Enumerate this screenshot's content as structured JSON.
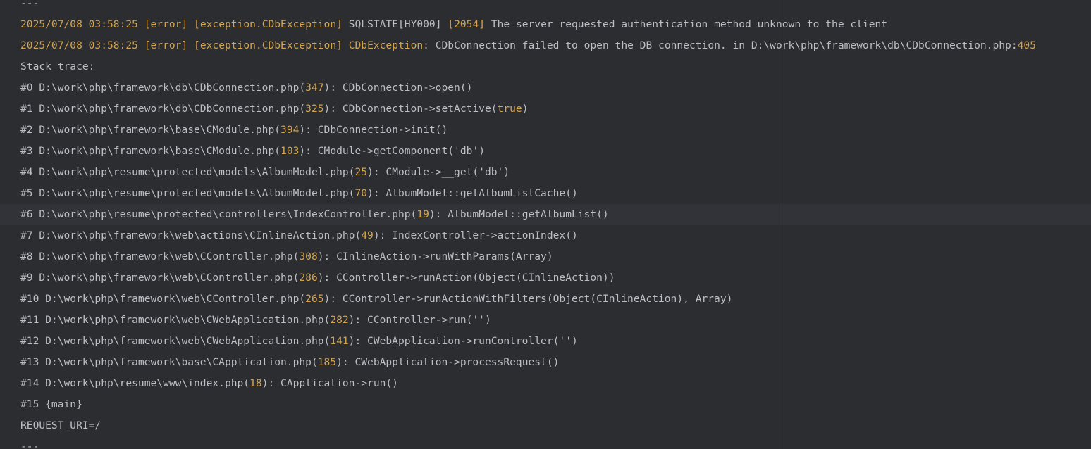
{
  "colors": {
    "background": "#2b2d30",
    "text": "#bcbec4",
    "highlight": "#d5a54e",
    "current_line": "#313339",
    "margin_guide": "#4a4d53"
  },
  "lines": [
    {
      "segs": [
        {
          "t": "---",
          "c": ""
        }
      ]
    },
    {
      "segs": [
        {
          "t": "2025/07/08 03:58:25",
          "c": "date"
        },
        {
          "t": " ",
          "c": ""
        },
        {
          "t": "[error]",
          "c": "kw"
        },
        {
          "t": " ",
          "c": ""
        },
        {
          "t": "[exception.CDbException]",
          "c": "kw"
        },
        {
          "t": " SQLSTATE[HY000] ",
          "c": ""
        },
        {
          "t": "[2054]",
          "c": "kw"
        },
        {
          "t": " The server requested authentication method unknown to the client",
          "c": ""
        }
      ]
    },
    {
      "segs": [
        {
          "t": "2025/07/08 03:58:25",
          "c": "date"
        },
        {
          "t": " ",
          "c": ""
        },
        {
          "t": "[error]",
          "c": "kw"
        },
        {
          "t": " ",
          "c": ""
        },
        {
          "t": "[exception.CDbException]",
          "c": "kw"
        },
        {
          "t": " ",
          "c": ""
        },
        {
          "t": "CDbException",
          "c": "kw"
        },
        {
          "t": ": CDbConnection failed to open the DB connection. in D:\\work\\php\\framework\\db\\CDbConnection.php:",
          "c": ""
        },
        {
          "t": "405",
          "c": "num"
        }
      ]
    },
    {
      "segs": [
        {
          "t": "Stack trace:",
          "c": ""
        }
      ]
    },
    {
      "segs": [
        {
          "t": "#0 D:\\work\\php\\framework\\db\\CDbConnection.php(",
          "c": ""
        },
        {
          "t": "347",
          "c": "num"
        },
        {
          "t": "): CDbConnection->open()",
          "c": ""
        }
      ]
    },
    {
      "segs": [
        {
          "t": "#1 D:\\work\\php\\framework\\db\\CDbConnection.php(",
          "c": ""
        },
        {
          "t": "325",
          "c": "num"
        },
        {
          "t": "): CDbConnection->setActive(",
          "c": ""
        },
        {
          "t": "true",
          "c": "kw"
        },
        {
          "t": ")",
          "c": ""
        }
      ]
    },
    {
      "segs": [
        {
          "t": "#2 D:\\work\\php\\framework\\base\\CModule.php(",
          "c": ""
        },
        {
          "t": "394",
          "c": "num"
        },
        {
          "t": "): CDbConnection->init()",
          "c": ""
        }
      ]
    },
    {
      "segs": [
        {
          "t": "#3 D:\\work\\php\\framework\\base\\CModule.php(",
          "c": ""
        },
        {
          "t": "103",
          "c": "num"
        },
        {
          "t": "): CModule->getComponent('db')",
          "c": ""
        }
      ]
    },
    {
      "segs": [
        {
          "t": "#4 D:\\work\\php\\resume\\protected\\models\\AlbumModel.php(",
          "c": ""
        },
        {
          "t": "25",
          "c": "num"
        },
        {
          "t": "): CModule->__get('db')",
          "c": ""
        }
      ]
    },
    {
      "segs": [
        {
          "t": "#5 D:\\work\\php\\resume\\protected\\models\\AlbumModel.php(",
          "c": ""
        },
        {
          "t": "70",
          "c": "num"
        },
        {
          "t": "): AlbumModel::getAlbumListCache()",
          "c": ""
        }
      ]
    },
    {
      "current": true,
      "segs": [
        {
          "t": "#6 D:\\work\\php\\resume\\protected\\controllers\\IndexController.php(",
          "c": ""
        },
        {
          "t": "19",
          "c": "num"
        },
        {
          "t": "): AlbumModel::getAlbumList()",
          "c": ""
        }
      ]
    },
    {
      "segs": [
        {
          "t": "#7 D:\\work\\php\\framework\\web\\actions\\CInlineAction.php(",
          "c": ""
        },
        {
          "t": "49",
          "c": "num"
        },
        {
          "t": "): IndexController->actionIndex()",
          "c": ""
        }
      ]
    },
    {
      "segs": [
        {
          "t": "#8 D:\\work\\php\\framework\\web\\CController.php(",
          "c": ""
        },
        {
          "t": "308",
          "c": "num"
        },
        {
          "t": "): CInlineAction->runWithParams(Array)",
          "c": ""
        }
      ]
    },
    {
      "segs": [
        {
          "t": "#9 D:\\work\\php\\framework\\web\\CController.php(",
          "c": ""
        },
        {
          "t": "286",
          "c": "num"
        },
        {
          "t": "): CController->runAction(Object(CInlineAction))",
          "c": ""
        }
      ]
    },
    {
      "segs": [
        {
          "t": "#10 D:\\work\\php\\framework\\web\\CController.php(",
          "c": ""
        },
        {
          "t": "265",
          "c": "num"
        },
        {
          "t": "): CController->runActionWithFilters(Object(CInlineAction), Array)",
          "c": ""
        }
      ]
    },
    {
      "segs": [
        {
          "t": "#11 D:\\work\\php\\framework\\web\\CWebApplication.php(",
          "c": ""
        },
        {
          "t": "282",
          "c": "num"
        },
        {
          "t": "): CController->run('')",
          "c": ""
        }
      ]
    },
    {
      "segs": [
        {
          "t": "#12 D:\\work\\php\\framework\\web\\CWebApplication.php(",
          "c": ""
        },
        {
          "t": "141",
          "c": "num"
        },
        {
          "t": "): CWebApplication->runController('')",
          "c": ""
        }
      ]
    },
    {
      "segs": [
        {
          "t": "#13 D:\\work\\php\\framework\\base\\CApplication.php(",
          "c": ""
        },
        {
          "t": "185",
          "c": "num"
        },
        {
          "t": "): CWebApplication->processRequest()",
          "c": ""
        }
      ]
    },
    {
      "segs": [
        {
          "t": "#14 D:\\work\\php\\resume\\www\\index.php(",
          "c": ""
        },
        {
          "t": "18",
          "c": "num"
        },
        {
          "t": "): CApplication->run()",
          "c": ""
        }
      ]
    },
    {
      "segs": [
        {
          "t": "#15 {main}",
          "c": ""
        }
      ]
    },
    {
      "segs": [
        {
          "t": "REQUEST_URI=/",
          "c": ""
        }
      ]
    },
    {
      "segs": [
        {
          "t": "---",
          "c": ""
        }
      ]
    }
  ]
}
